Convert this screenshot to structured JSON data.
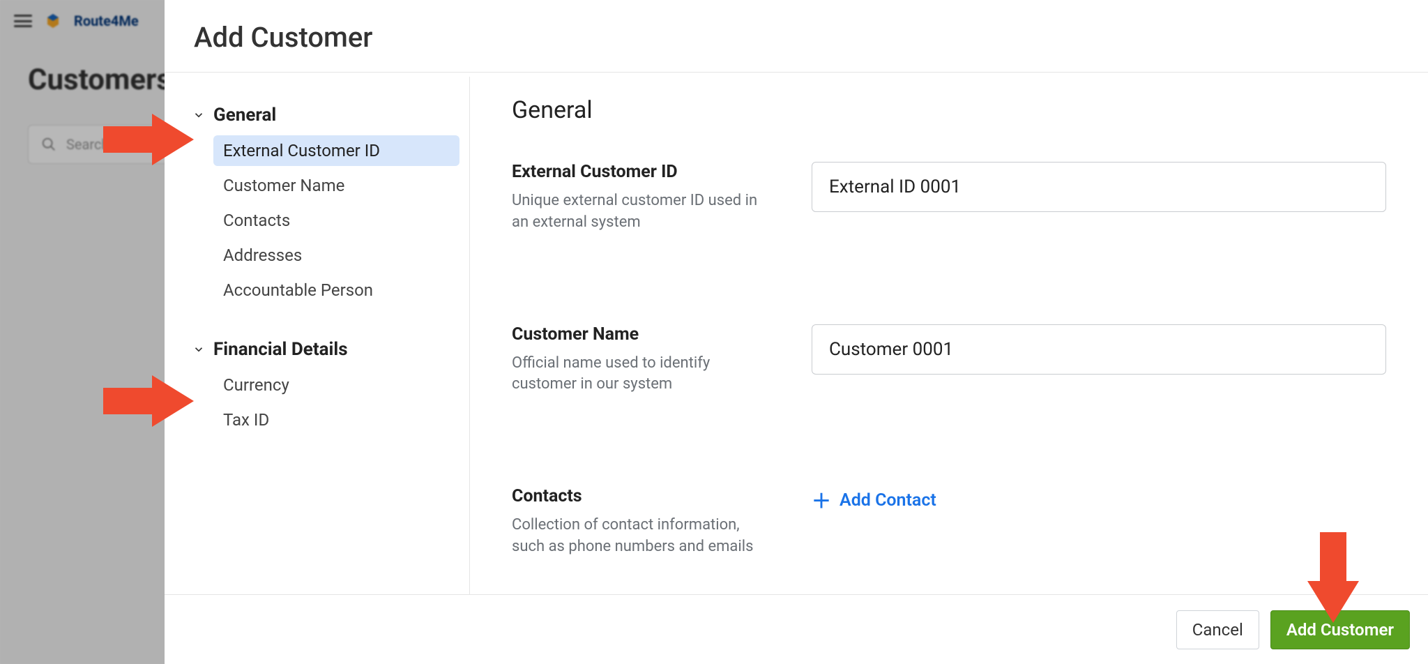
{
  "background": {
    "brand": "Route4Me",
    "page_title": "Customers",
    "search_placeholder": "Search"
  },
  "modal": {
    "title": "Add Customer",
    "content_heading": "General",
    "footer": {
      "cancel_label": "Cancel",
      "submit_label": "Add Customer"
    }
  },
  "sidebar": {
    "sections": [
      {
        "label": "General",
        "items": [
          {
            "label": "External Customer ID",
            "active": true
          },
          {
            "label": "Customer Name"
          },
          {
            "label": "Contacts"
          },
          {
            "label": "Addresses"
          },
          {
            "label": "Accountable Person"
          }
        ]
      },
      {
        "label": "Financial Details",
        "items": [
          {
            "label": "Currency"
          },
          {
            "label": "Tax ID"
          }
        ]
      }
    ]
  },
  "fields": {
    "external_customer_id": {
      "label": "External Customer ID",
      "hint": "Unique external customer ID used in an external system",
      "value": "External ID 0001"
    },
    "customer_name": {
      "label": "Customer Name",
      "hint": "Official name used to identify customer in our system",
      "value": "Customer 0001"
    },
    "contacts": {
      "label": "Contacts",
      "hint": "Collection of contact information, such as phone numbers and emails",
      "add_label": "Add Contact"
    }
  },
  "annotations": {
    "arrow_color": "#ef4a2e"
  }
}
